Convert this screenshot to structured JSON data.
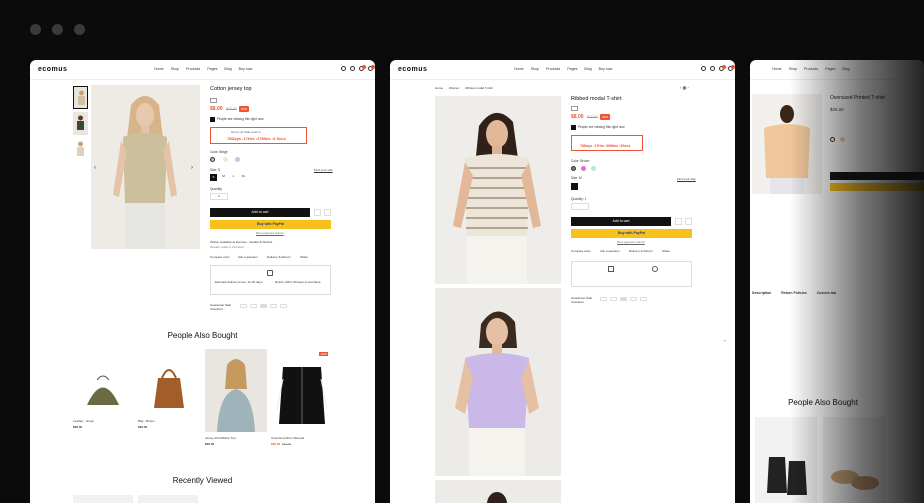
{
  "window_dots": [
    "dot",
    "dot",
    "dot"
  ],
  "store": {
    "logo": "ecomus",
    "nav": [
      "Home",
      "Shop",
      "Products",
      "Pages",
      "Blog",
      "Buy now"
    ]
  },
  "p1": {
    "title": "Cotton jersey top",
    "price": "$8.00",
    "old_price": "$10.00",
    "discount": "20%",
    "viewing": "People are viewing this right now",
    "hurry": "Hurry up! Sale ends in:",
    "countdown": "78Days :17Hrs :27Mins :3 Secs",
    "color_label": "Color: Beige",
    "size_label": "Size: S",
    "sizes": [
      "S",
      "M",
      "L",
      "XL"
    ],
    "size_guide": "Find your size",
    "qty_label": "Quantity",
    "qty": "1",
    "add_to_cart": "Add to cart",
    "buy_with": "Buy with PayPal",
    "more_payment": "More payment options",
    "pickup": "Pickup available at Ecomus - Seattle & Wolcott",
    "pickup_sub": "Usually ready in 24 hours",
    "actions": [
      "Compare color",
      "Ask a question",
      "Delivery & Return",
      "Share"
    ],
    "delivery_1": "Estimate delivery times: 12-26 days",
    "delivery_2": "Return within 30 days of purchase.",
    "checkout": "Guarantee Safe Checkout",
    "people_bought": "People Also Bought",
    "products": [
      {
        "name": "Leather - Green",
        "price": "$58.00"
      },
      {
        "name": "Bag - Brown",
        "price": "$30.00"
      },
      {
        "name": "Jersey Pull Ribbon Top",
        "price": "$36.00"
      },
      {
        "name": "Oversized Short Sleeved",
        "price": "$35.00",
        "old": "$45.00",
        "tag": "-20%"
      }
    ],
    "recently": "Recently Viewed"
  },
  "p2": {
    "breadcrumb": [
      "Home",
      "Women",
      "Ribbed modal T-shirt"
    ],
    "title": "Ribbed modal T-shirt",
    "price": "$8.00",
    "old_price": "$10.00",
    "discount": "20%",
    "viewing": "People are viewing this right now",
    "countdown": "78Days :17Hrs :26Mins :3Secs",
    "color_label": "Color: Brown",
    "size_label": "Size: M",
    "find_size": "Find your size",
    "qty_label": "Quantity: 1",
    "add_to_cart": "Add to cart",
    "buy_with": "Buy with PayPal",
    "more_payment": "More payment options",
    "actions": [
      "Compare color",
      "Ask a question",
      "Delivery & Return",
      "Share"
    ],
    "checkout": "Guarantee Safe Checkout"
  },
  "p3": {
    "title": "Oversized Printed T-shirt",
    "price": "$25.00",
    "tabs": [
      "Description",
      "Return Policies",
      "Custom tab"
    ],
    "people_bought": "People Also Bought"
  },
  "colors": {
    "accent": "#e53935",
    "yellow": "#f8c01b",
    "dark": "#000000"
  }
}
